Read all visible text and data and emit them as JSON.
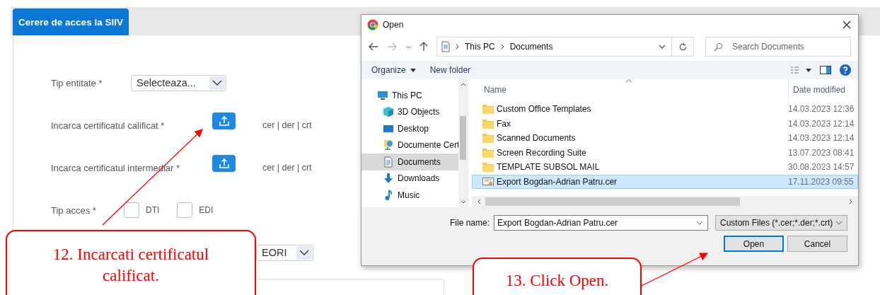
{
  "page": {
    "tab": {
      "label": "Cerere de acces la SIIV",
      "selected": true
    },
    "form": [
      {
        "kind": "select",
        "label": "Tip entitate *",
        "value": "Selecteaza..."
      },
      {
        "kind": "upload",
        "label": "Incarca certificatul calificat *",
        "formats": "cer | der | crt"
      },
      {
        "kind": "upload",
        "label": "Incarca certificatul intermediar *",
        "formats": "cer | der | crt"
      },
      {
        "kind": "checkboxes",
        "label": "Tip acces *",
        "options": [
          {
            "label": "DTI",
            "checked": false
          },
          {
            "label": "EDI",
            "checked": false
          }
        ]
      },
      {
        "kind": "select",
        "value": "EORI"
      }
    ]
  },
  "dialog": {
    "title": "Open",
    "path": [
      "This PC",
      "Documents"
    ],
    "search": {
      "placeholder": "Search Documents"
    },
    "toolbar": [
      "Organize",
      "New folder"
    ],
    "sidebar": [
      {
        "label": "This PC",
        "selected": false,
        "children": [
          {
            "label": "3D Objects",
            "selected": false
          },
          {
            "label": "Desktop",
            "selected": false
          },
          {
            "label": "Documente Cert",
            "selected": false
          },
          {
            "label": "Documents",
            "selected": true
          },
          {
            "label": "Downloads",
            "selected": false
          },
          {
            "label": "Music",
            "selected": false
          }
        ]
      }
    ],
    "columns": [
      "Name",
      "Date modified"
    ],
    "rows": [
      {
        "name": "Custom Office Templates",
        "date": "14.03.2023 12:36",
        "kind": "folder",
        "selected": false
      },
      {
        "name": "Fax",
        "date": "14.03.2023 12:14",
        "kind": "folder",
        "selected": false
      },
      {
        "name": "Scanned Documents",
        "date": "14.03.2023 12:14",
        "kind": "folder",
        "selected": false
      },
      {
        "name": "Screen Recording Suite",
        "date": "13.07.2023 08:41",
        "kind": "folder",
        "selected": false
      },
      {
        "name": "TEMPLATE SUBSOL MAIL",
        "date": "30.08.2023 14:57",
        "kind": "folder",
        "selected": false
      },
      {
        "name": "Export Bogdan-Adrian Patru.cer",
        "date": "17.11.2023 09:55",
        "kind": "certificate",
        "selected": true
      }
    ],
    "file_name_label": "File name:",
    "file_name": "Export Bogdan-Adrian Patru.cer",
    "filter": "Custom Files (*.cer;*.der;*.crt)",
    "buttons": [
      {
        "label": "Open",
        "default": true
      },
      {
        "label": "Cancel",
        "default": false
      }
    ]
  },
  "annotations": [
    {
      "text": "12. Incarcati certificatul calificat."
    },
    {
      "text": "13. Click Open."
    }
  ]
}
